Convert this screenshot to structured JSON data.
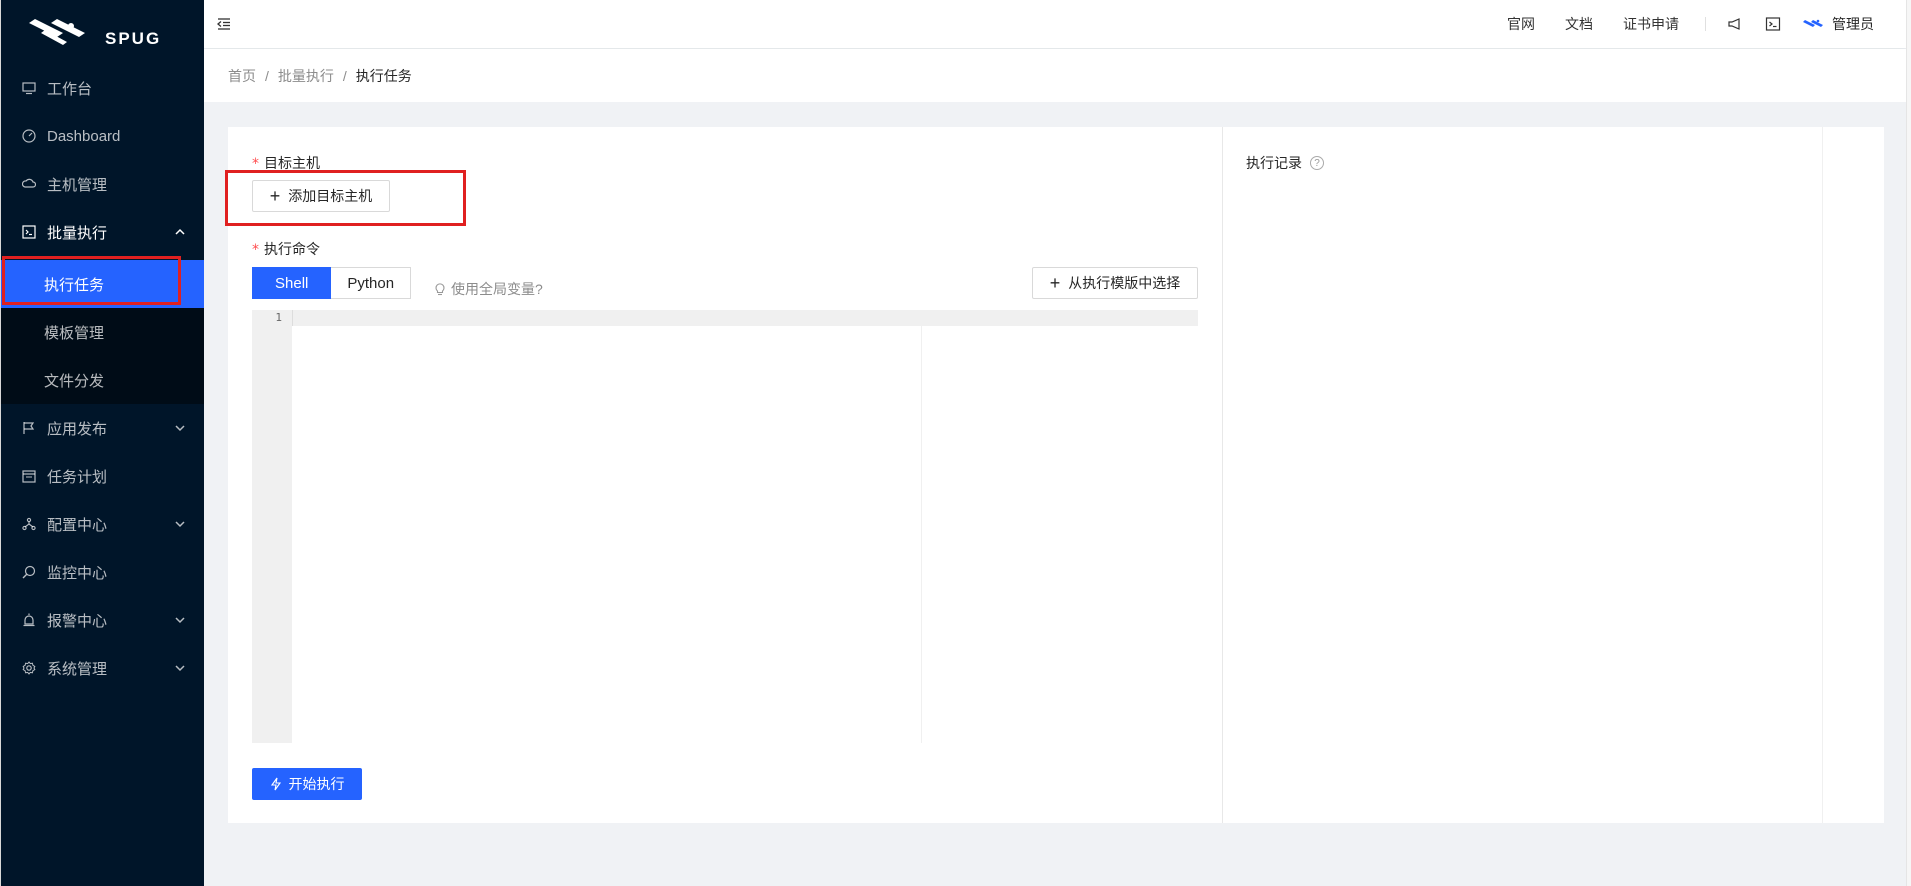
{
  "logo": {
    "text": "SPUG"
  },
  "sidebar": {
    "items": [
      {
        "label": "工作台",
        "icon": "desktop-icon"
      },
      {
        "label": "Dashboard",
        "icon": "dashboard-icon"
      },
      {
        "label": "主机管理",
        "icon": "cloud-server-icon"
      },
      {
        "label": "批量执行",
        "icon": "code-icon",
        "expanded": true,
        "children": [
          {
            "label": "执行任务",
            "active": true
          },
          {
            "label": "模板管理"
          },
          {
            "label": "文件分发"
          }
        ]
      },
      {
        "label": "应用发布",
        "icon": "flag-icon"
      },
      {
        "label": "任务计划",
        "icon": "schedule-icon"
      },
      {
        "label": "配置中心",
        "icon": "deployment-icon"
      },
      {
        "label": "监控中心",
        "icon": "monitor-icon"
      },
      {
        "label": "报警中心",
        "icon": "alert-icon"
      },
      {
        "label": "系统管理",
        "icon": "setting-icon"
      }
    ]
  },
  "header": {
    "links": [
      "官网",
      "文档",
      "证书申请"
    ],
    "user": "管理员"
  },
  "breadcrumb": [
    "首页",
    "批量执行",
    "执行任务"
  ],
  "form": {
    "target_label": "目标主机",
    "add_target_button": "添加目标主机",
    "command_label": "执行命令",
    "lang_options": [
      "Shell",
      "Python"
    ],
    "lang_selected": "Shell",
    "global_var_hint": "使用全局变量?",
    "template_button": "从执行模版中选择",
    "editor_line_numbers": [
      "1"
    ],
    "run_button": "开始执行"
  },
  "records": {
    "title": "执行记录"
  },
  "colors": {
    "primary": "#2563ff",
    "sidebar_bg": "#001529",
    "required": "#ff4d4f",
    "highlight_box": "#e02020"
  }
}
